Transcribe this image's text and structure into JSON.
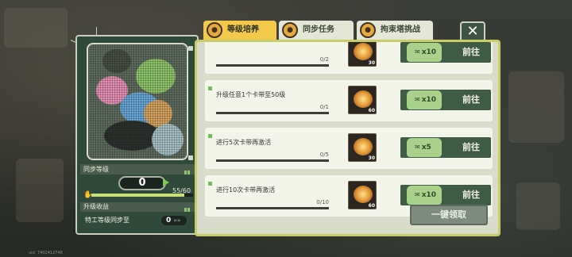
{
  "tabs": [
    {
      "label": "等级培养",
      "icon": "memory-icon",
      "active": true
    },
    {
      "label": "同步任务",
      "icon": "memory-icon",
      "active": false
    },
    {
      "label": "拘束塔挑战",
      "icon": "memory-icon",
      "active": false
    }
  ],
  "left_panel": {
    "sync_level_label": "同步等级",
    "level": "0",
    "exp_text": "55/60",
    "exp_fraction": 0.917,
    "income_label": "升级收益",
    "agent_label": "特工等级同步至",
    "agent_value": "0"
  },
  "tasks": [
    {
      "title": "",
      "progress": "0/2",
      "reward_qty": "30",
      "ticket": "x10",
      "button": "前往"
    },
    {
      "title": "升级任意1个卡带至50级",
      "progress": "0/1",
      "reward_qty": "60",
      "ticket": "x10",
      "button": "前往"
    },
    {
      "title": "进行5次卡带再激活",
      "progress": "0/5",
      "reward_qty": "30",
      "ticket": "x5",
      "button": "前往"
    },
    {
      "title": "进行10次卡带再激活",
      "progress": "0/10",
      "reward_qty": "60",
      "ticket": "x10",
      "button": "前往"
    }
  ],
  "claim_all_label": "一键领取",
  "close_label": "✕",
  "uid": "uid: 7402412748",
  "colors": {
    "accent": "#f2c94a",
    "panel": "#2f4a3a",
    "button": "#3f5c44"
  }
}
